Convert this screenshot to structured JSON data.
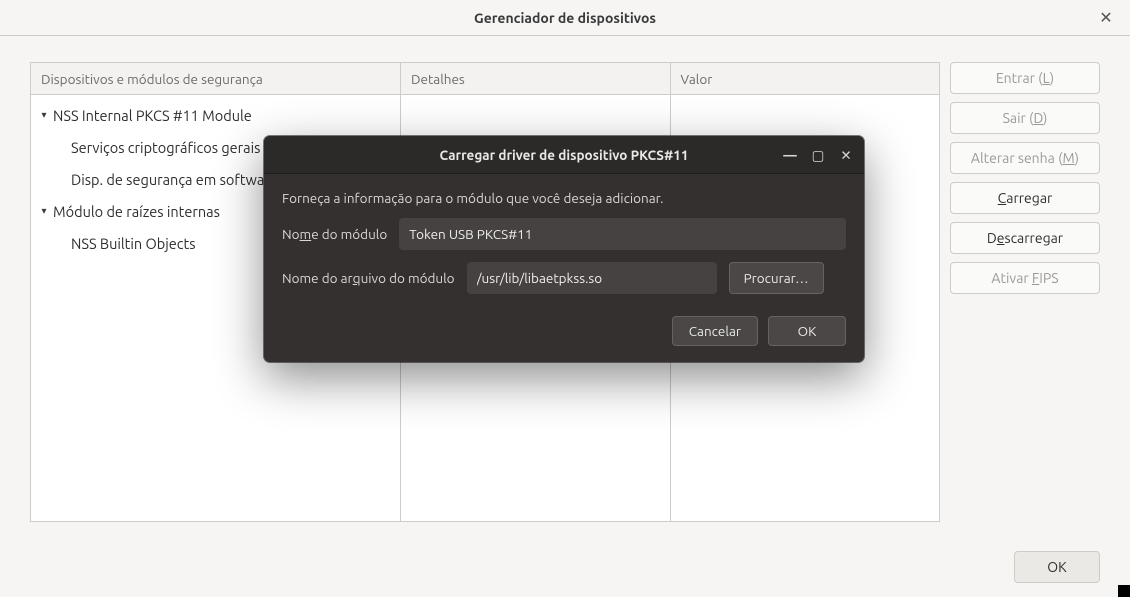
{
  "main": {
    "title": "Gerenciador de dispositivos",
    "ok_label": "OK",
    "headers": {
      "tree": "Dispositivos e módulos de segurança",
      "details": "Detalhes",
      "value": "Valor"
    },
    "tree": [
      {
        "kind": "parent",
        "label": "NSS Internal PKCS #11 Module"
      },
      {
        "kind": "child",
        "label": "Serviços criptográficos gerais"
      },
      {
        "kind": "child",
        "label": "Disp. de segurança em software"
      },
      {
        "kind": "parent",
        "label": "Módulo de raízes internas"
      },
      {
        "kind": "child",
        "label": "NSS Builtin Objects"
      }
    ],
    "buttons": {
      "login": {
        "pre": "Entrar (",
        "u": "L",
        "post": ")",
        "enabled": false
      },
      "logout": {
        "pre": "Sair (",
        "u": "D",
        "post": ")",
        "enabled": false
      },
      "chpass": {
        "pre": "Alterar senha (",
        "u": "M",
        "post": ")",
        "enabled": false
      },
      "load": {
        "pre": "",
        "u": "C",
        "post": "arregar",
        "enabled": true
      },
      "unload": {
        "pre": "D",
        "u": "e",
        "post": "scarregar",
        "enabled": true
      },
      "fips": {
        "pre": "Ativar ",
        "u": "F",
        "post": "IPS",
        "enabled": false
      }
    }
  },
  "dialog": {
    "title": "Carregar driver de dispositivo PKCS#11",
    "hint": "Forneça a informação para o módulo que você deseja adicionar.",
    "name_label": {
      "pre": "No",
      "u": "m",
      "post": "e do módulo"
    },
    "name_value": "Token USB PKCS#11",
    "file_label": {
      "pre": "Nome do ar",
      "u": "q",
      "post": "uivo do módulo"
    },
    "file_value": "/usr/lib/libaetpkss.so",
    "browse": {
      "pre": "",
      "u": "P",
      "post": "rocurar…"
    },
    "cancel": "Cancelar",
    "ok": "OK"
  }
}
